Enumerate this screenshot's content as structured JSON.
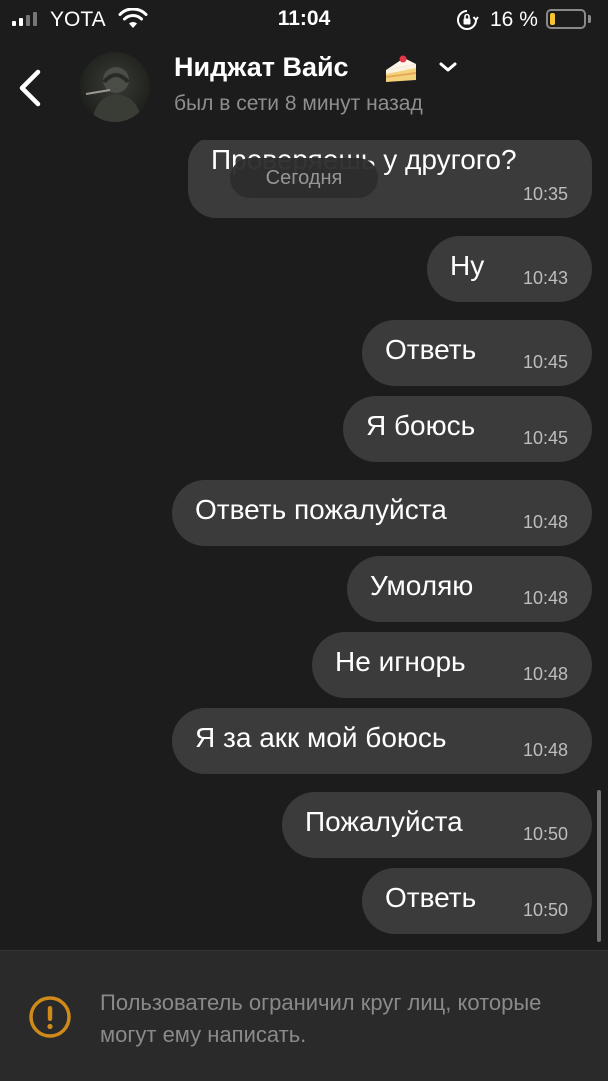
{
  "status_bar": {
    "carrier": "YOTA",
    "time": "11:04",
    "battery_percent": "16 %",
    "battery_level": 0.16,
    "battery_color": "#f6c431"
  },
  "header": {
    "contact_name": "Ниджат Вайс",
    "last_seen": "был в сети 8 минут назад",
    "icons": [
      "back-chevron",
      "cake",
      "chevron-down"
    ]
  },
  "chat": {
    "date_label": "Сегодня",
    "messages": [
      {
        "text": "Проверяешь у другого?",
        "time": "10:35"
      },
      {
        "text": "Ну",
        "time": "10:43"
      },
      {
        "text": "Ответь",
        "time": "10:45"
      },
      {
        "text": "Я боюсь",
        "time": "10:45"
      },
      {
        "text": "Ответь пожалуйста",
        "time": "10:48"
      },
      {
        "text": "Умоляю",
        "time": "10:48"
      },
      {
        "text": "Не игнорь",
        "time": "10:48"
      },
      {
        "text": "Я за акк мой боюсь",
        "time": "10:48"
      },
      {
        "text": "Пожалуйста",
        "time": "10:50"
      },
      {
        "text": "Ответь",
        "time": "10:50"
      }
    ]
  },
  "footer": {
    "notice": "Пользователь ограничил круг лиц, которые могут ему написать.",
    "icon": "warning",
    "accent": "#d08a1a"
  }
}
